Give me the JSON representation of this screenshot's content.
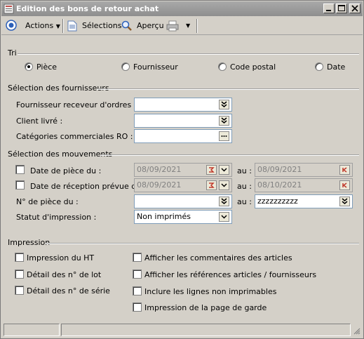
{
  "window": {
    "title": "Edition des bons de retour achat"
  },
  "toolbar": {
    "actions": "Actions",
    "selections": "Sélections",
    "apercu": "Aperçu"
  },
  "tri": {
    "legend": "Tri",
    "options": [
      "Pièce",
      "Fournisseur",
      "Code postal",
      "Date"
    ],
    "selected": "Pièce"
  },
  "fournisseurs": {
    "legend": "Sélection des fournisseurs",
    "receveur_label": "Fournisseur receveur d'ordres :",
    "client_label": "Client livré :",
    "categories_label": "Catégories commerciales RO :"
  },
  "mouvements": {
    "legend": "Sélection des mouvements",
    "date_piece_label": "Date de pièce du :",
    "date_piece_from": "08/09/2021",
    "date_piece_to": "08/09/2021",
    "date_reception_label": "Date de réception prévue du :",
    "date_reception_from": "08/09/2021",
    "date_reception_to": "08/10/2021",
    "au": "au :",
    "num_piece_label": "N° de pièce du :",
    "num_piece_to": "zzzzzzzzzz",
    "statut_label": "Statut d'impression :",
    "statut_value": "Non imprimés"
  },
  "impression": {
    "legend": "Impression",
    "left": [
      "Impression du HT",
      "Détail des n° de lot",
      "Détail des n° de série"
    ],
    "right": [
      "Afficher les commentaires des articles",
      "Afficher les références articles / fournisseurs",
      "Inclure les lignes non imprimables",
      "Impression de la page de garde"
    ]
  },
  "colors": {
    "title_bar": "#8e8e8e",
    "face": "#d4d0c8",
    "field_border": "#7f9db9"
  }
}
